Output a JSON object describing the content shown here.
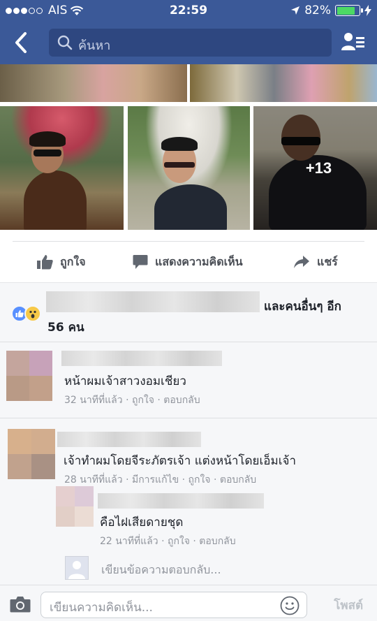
{
  "status_bar": {
    "carrier": "AIS",
    "time": "22:59",
    "battery_percent_text": "82%",
    "battery_level": 0.82
  },
  "nav": {
    "search_placeholder": "ค้นหา"
  },
  "photos": {
    "more_count": "+13"
  },
  "actions": {
    "like": "ถูกใจ",
    "comment": "แสดงความคิดเห็น",
    "share": "แชร์"
  },
  "reactions": {
    "and_others": "และคนอื่นๆ อีก",
    "count": "56 คน"
  },
  "comments": [
    {
      "text": "หน้าผมเจ้าสาวงอมเชียว",
      "meta": "32 นาทีที่แล้ว · ถูกใจ · ตอบกลับ"
    },
    {
      "text": "เจ้าทำผมโดยจีระภัตรเจ้า แต่งหน้าโดยเอ็มเจ้า",
      "meta": "28 นาทีที่แล้ว · มีการแก้ไข · ถูกใจ · ตอบกลับ",
      "reply": {
        "text": "คือไฝเสียดายชุด",
        "meta": "22 นาทีที่แล้ว · ถูกใจ · ตอบกลับ"
      }
    }
  ],
  "reply_box": {
    "placeholder": "เขียนข้อความตอบกลับ..."
  },
  "composer": {
    "placeholder": "เขียนความคิดเห็น...",
    "post_label": "โพสต์"
  },
  "colors": {
    "brand": "#3b5998",
    "meta_gray": "#90949c",
    "battery_green": "#4cd964"
  }
}
